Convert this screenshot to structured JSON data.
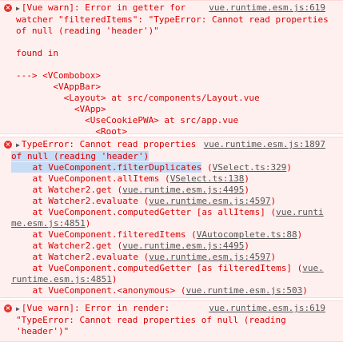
{
  "entry1": {
    "prefix": "[Vue warn]: Error in getter for",
    "source": "vue.runtime.esm.js:619",
    "lines": [
      "watcher \"filteredItems\": \"TypeError: Cannot read properties",
      "of null (reading 'header')\""
    ],
    "found_in": "found in",
    "tree": [
      "---> <VCombobox>",
      "       <VAppBar>",
      "         <Layout> at src/components/Layout.vue",
      "           <VApp>",
      "             <UseCookiePWA> at src/app.vue",
      "               <Root>"
    ]
  },
  "entry2": {
    "prefix": "TypeError: Cannot read properties",
    "source": "vue.runtime.esm.js:1897",
    "line2": "of null (reading 'header')",
    "stack": [
      {
        "text": "    at VueComponent.filterDuplicates",
        "paren_open": " (",
        "link": "VSelect.ts:329",
        "paren_close": ")",
        "highlight": true
      },
      {
        "text": "    at VueComponent.allItems",
        "paren_open": " (",
        "link": "VSelect.ts:138",
        "paren_close": ")"
      },
      {
        "text": "    at Watcher2.get",
        "paren_open": " (",
        "link": "vue.runtime.esm.js:4495",
        "paren_close": ")"
      },
      {
        "text": "    at Watcher2.evaluate",
        "paren_open": " (",
        "link": "vue.runtime.esm.js:4597",
        "paren_close": ")"
      },
      {
        "text": "    at VueComponent.computedGetter [as allItems]",
        "paren_open": " (",
        "link": "vue.runti",
        "paren_close": ""
      },
      {
        "text": "",
        "paren_open": "",
        "link": "me.esm.js:4851",
        "paren_close": ")"
      },
      {
        "text": "    at VueComponent.filteredItems",
        "paren_open": " (",
        "link": "VAutocomplete.ts:88",
        "paren_close": ")"
      },
      {
        "text": "    at Watcher2.get",
        "paren_open": " (",
        "link": "vue.runtime.esm.js:4495",
        "paren_close": ")"
      },
      {
        "text": "    at Watcher2.evaluate",
        "paren_open": " (",
        "link": "vue.runtime.esm.js:4597",
        "paren_close": ")"
      },
      {
        "text": "    at VueComponent.computedGetter [as filteredItems]",
        "paren_open": " (",
        "link": "vue.",
        "paren_close": ""
      },
      {
        "text": "",
        "paren_open": "",
        "link": "runtime.esm.js:4851",
        "paren_close": ")"
      },
      {
        "text": "    at VueComponent.<anonymous>",
        "paren_open": " (",
        "link": "vue.runtime.esm.js:503",
        "paren_close": ")"
      }
    ]
  },
  "entry3": {
    "prefix": "[Vue warn]: Error in render:",
    "source": "vue.runtime.esm.js:619",
    "lines": [
      "\"TypeError: Cannot read properties of null (reading",
      "'header')\""
    ]
  },
  "icons": {
    "error": "error-circle-icon",
    "expand": "triangle-right-icon"
  },
  "colors": {
    "error_text": "#dc0000",
    "error_bg": "#fff0f0",
    "link": "#555555",
    "highlight": "#c7dcf5"
  }
}
